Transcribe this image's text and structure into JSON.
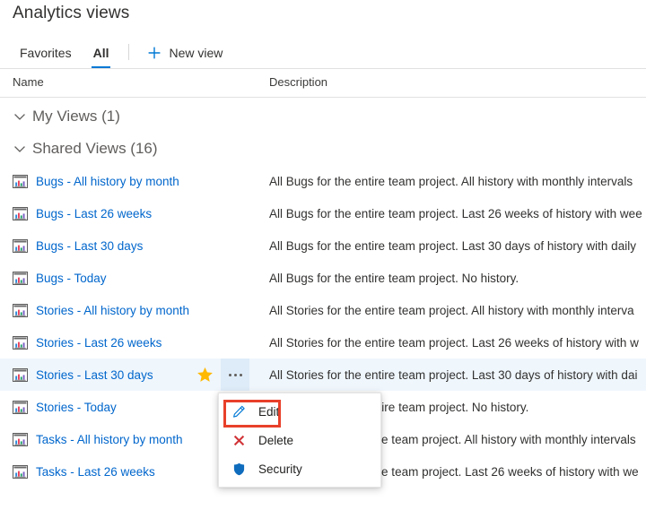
{
  "page": {
    "title": "Analytics views"
  },
  "tabs": [
    {
      "label": "Favorites",
      "active": false,
      "name": "tab-favorites"
    },
    {
      "label": "All",
      "active": true,
      "name": "tab-all"
    }
  ],
  "commands": {
    "new_view": {
      "label": "New view",
      "icon": "plus-icon",
      "accent": "#0078d4"
    }
  },
  "columns": {
    "name": "Name",
    "description": "Description"
  },
  "groups": [
    {
      "label": "My Views (1)",
      "name": "group-my-views",
      "expanded": true,
      "chevron": "chevron-down-icon"
    },
    {
      "label": "Shared Views (16)",
      "name": "group-shared-views",
      "expanded": true,
      "chevron": "chevron-down-icon"
    }
  ],
  "rows": [
    {
      "name": "Bugs - All history by month",
      "description": "All Bugs for the entire team project. All history with monthly intervals",
      "selected": false,
      "favorite": false,
      "icon": "chart-report-icon"
    },
    {
      "name": "Bugs - Last 26 weeks",
      "description": "All Bugs for the entire team project. Last 26 weeks of history with wee",
      "selected": false,
      "favorite": false,
      "icon": "chart-report-icon"
    },
    {
      "name": "Bugs - Last 30 days",
      "description": "All Bugs for the entire team project. Last 30 days of history with daily",
      "selected": false,
      "favorite": false,
      "icon": "chart-report-icon"
    },
    {
      "name": "Bugs - Today",
      "description": "All Bugs for the entire team project. No history.",
      "selected": false,
      "favorite": false,
      "icon": "chart-report-icon"
    },
    {
      "name": "Stories - All history by month",
      "description": "All Stories for the entire team project. All history with monthly interva",
      "selected": false,
      "favorite": false,
      "icon": "chart-report-icon"
    },
    {
      "name": "Stories - Last 26 weeks",
      "description": "All Stories for the entire team project. Last 26 weeks of history with w",
      "selected": false,
      "favorite": false,
      "icon": "chart-report-icon"
    },
    {
      "name": "Stories - Last 30 days",
      "description": "All Stories for the entire team project. Last 30 days of history with dai",
      "selected": true,
      "favorite": true,
      "icon": "chart-report-icon"
    },
    {
      "name": "Stories - Today",
      "description": "All Stories for the entire team project. No history.",
      "selected": false,
      "favorite": false,
      "icon": "chart-report-icon"
    },
    {
      "name": "Tasks - All history by month",
      "description": "All Tasks for the entire team project. All history with monthly intervals",
      "selected": false,
      "favorite": false,
      "icon": "chart-report-icon"
    },
    {
      "name": "Tasks - Last 26 weeks",
      "description": "All Tasks for the entire team project. Last 26 weeks of history with we",
      "selected": false,
      "favorite": false,
      "icon": "chart-report-icon"
    }
  ],
  "context_menu": {
    "items": [
      {
        "label": "Edit",
        "icon": "pencil-icon",
        "color": "#0078d4",
        "highlighted": true
      },
      {
        "label": "Delete",
        "icon": "x-close-icon",
        "color": "#d13438",
        "highlighted": false
      },
      {
        "label": "Security",
        "icon": "shield-icon",
        "color": "#0078d4",
        "highlighted": false
      }
    ]
  },
  "annotation": {
    "target": "Edit",
    "color": "#e8402a"
  },
  "colors": {
    "link": "#0066cc",
    "accent": "#0078d4",
    "selected_row": "#eff6fc",
    "star": "#ffb900",
    "annotation": "#e8402a"
  }
}
